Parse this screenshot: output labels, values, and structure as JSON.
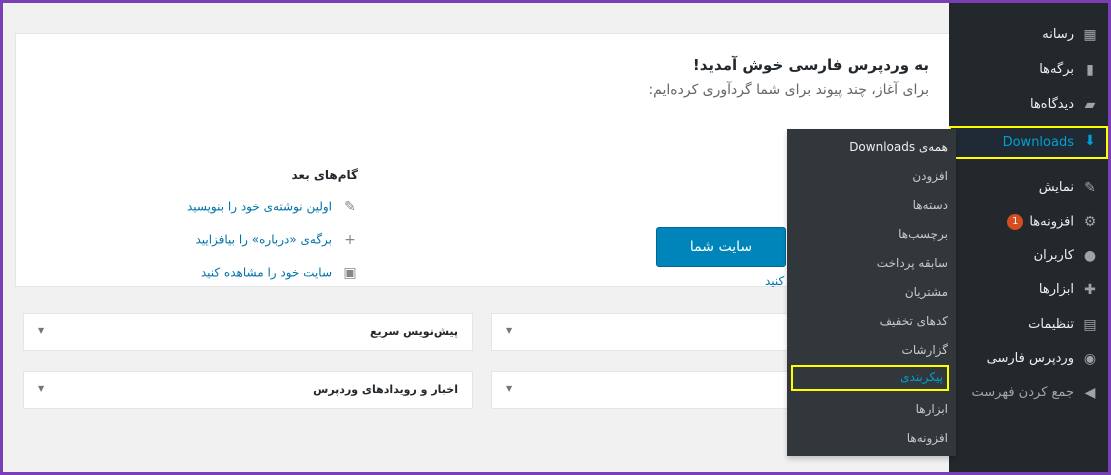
{
  "sidebar": {
    "items": [
      {
        "label": "رسانه",
        "icon": "media-icon"
      },
      {
        "label": "برگه‌ها",
        "icon": "page-icon"
      },
      {
        "label": "دیدگاه‌ها",
        "icon": "comment-icon"
      },
      {
        "label": "Downloads",
        "icon": "download-icon"
      },
      {
        "label": "نمایش",
        "icon": "appearance-icon"
      },
      {
        "label": "افزونه‌ها",
        "icon": "plugin-icon",
        "badge": "1"
      },
      {
        "label": "کاربران",
        "icon": "users-icon"
      },
      {
        "label": "ابزارها",
        "icon": "tools-icon"
      },
      {
        "label": "تنظیمات",
        "icon": "settings-icon"
      },
      {
        "label": "وردپرس فارسی",
        "icon": "wp-persian-icon"
      },
      {
        "label": "جمع کردن فهرست",
        "icon": "collapse-icon"
      }
    ]
  },
  "flyout": {
    "items": [
      "همه‌ی Downloads",
      "افزودن",
      "دسته‌ها",
      "برچسب‌ها",
      "سابقه پرداخت",
      "مشتریان",
      "کدهای تخفیف",
      "گزارشات",
      "پیکربندی",
      "ابزارها",
      "افزونه‌ها"
    ]
  },
  "welcome": {
    "title": "به وردپرس فارسی خوش آمدید!",
    "subtitle": "برای آغاز، چند پیوند برای شما گردآوری کرده‌ایم:",
    "cta_label": "سایت شما",
    "cta_link_partial": "کنید",
    "next_steps_title": "گام‌های بعد",
    "steps": [
      {
        "label": "اولین نوشته‌ی خود را بنویسید",
        "icon": "edit-icon"
      },
      {
        "label": "برگه‌ی «درباره» را بیافزایید",
        "icon": "plus-icon"
      },
      {
        "label": "سایت خود را مشاهده کنید",
        "icon": "view-icon"
      }
    ]
  },
  "widgets": {
    "quick_draft": "پیش‌نویس سریع",
    "wp_news": "اخبار و رویدادهای وردپرس"
  },
  "colors": {
    "sidebar_bg": "#23282d",
    "flyout_bg": "#32373c",
    "accent": "#00a0d2",
    "highlight": "#ffff00",
    "button": "#0085ba",
    "frame": "#7b3fb5"
  }
}
